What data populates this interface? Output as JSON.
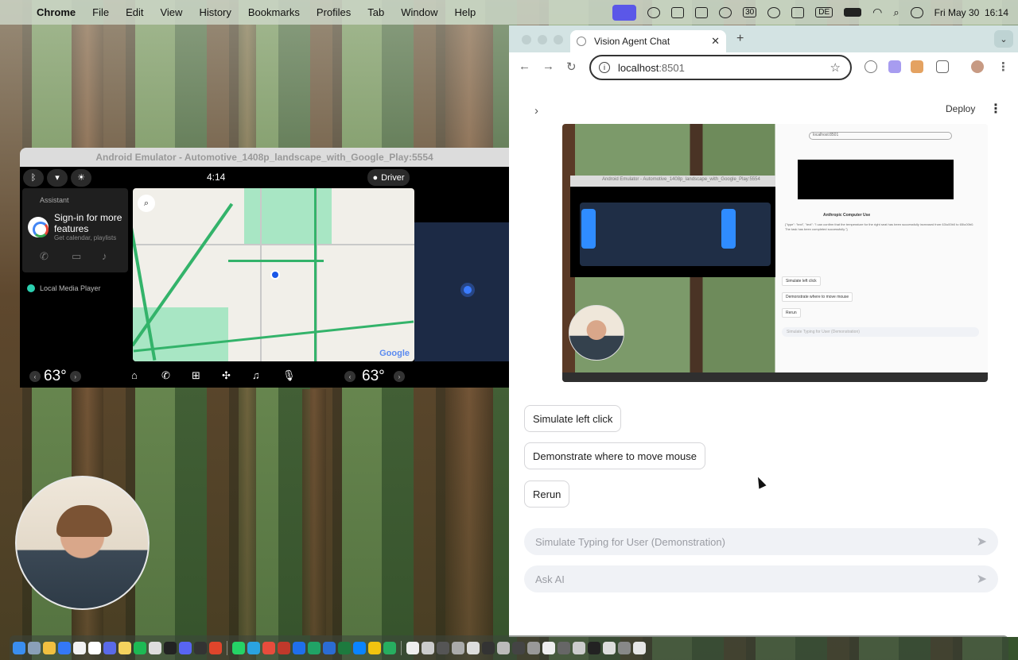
{
  "menubar": {
    "app": "Chrome",
    "items": [
      "File",
      "Edit",
      "View",
      "History",
      "Bookmarks",
      "Profiles",
      "Tab",
      "Window",
      "Help"
    ],
    "calendar_badge": "30",
    "keyboard_layout": "DE",
    "datetime": "Fri May 30  16:14"
  },
  "emulator": {
    "title": "Android Emulator - Automotive_1408p_landscape_with_Google_Play:5554",
    "time": "4:14",
    "profile": "Driver",
    "assistant_label": "Assistant",
    "assistant_title": "Sign-in for more features",
    "assistant_subtitle": "Get calendar, playlists",
    "media_label": "Local Media Player",
    "temp_left": "63°",
    "temp_right": "63°",
    "map_logo": "Google"
  },
  "browser": {
    "tab_title": "Vision Agent Chat",
    "url_host": "localhost",
    "url_port": ":8501"
  },
  "app": {
    "deploy_label": "Deploy",
    "embedded_screenshot": {
      "emulator_title": "Android Emulator - Automotive_1408p_landscape_with_Google_Play:5554",
      "url": "localhost:8501",
      "heading": "Anthropic Computer Use",
      "result_text": "{\"type\": \"text\", \"text\": \"I can confirm that the temperature for the right seat has been successfully increased from 63\\u00b0 to 65\\u00b0. The task has been completed successfully.\"}",
      "buttons": [
        "Simulate left click",
        "Demonstrate where to move mouse",
        "Rerun"
      ],
      "input_placeholder": "Simulate Typing for User (Demonstration)"
    },
    "buttons": {
      "left_click": "Simulate left click",
      "move_mouse": "Demonstrate where to move mouse",
      "rerun": "Rerun"
    },
    "typing_placeholder": "Simulate Typing for User (Demonstration)",
    "ask_placeholder": "Ask AI"
  }
}
